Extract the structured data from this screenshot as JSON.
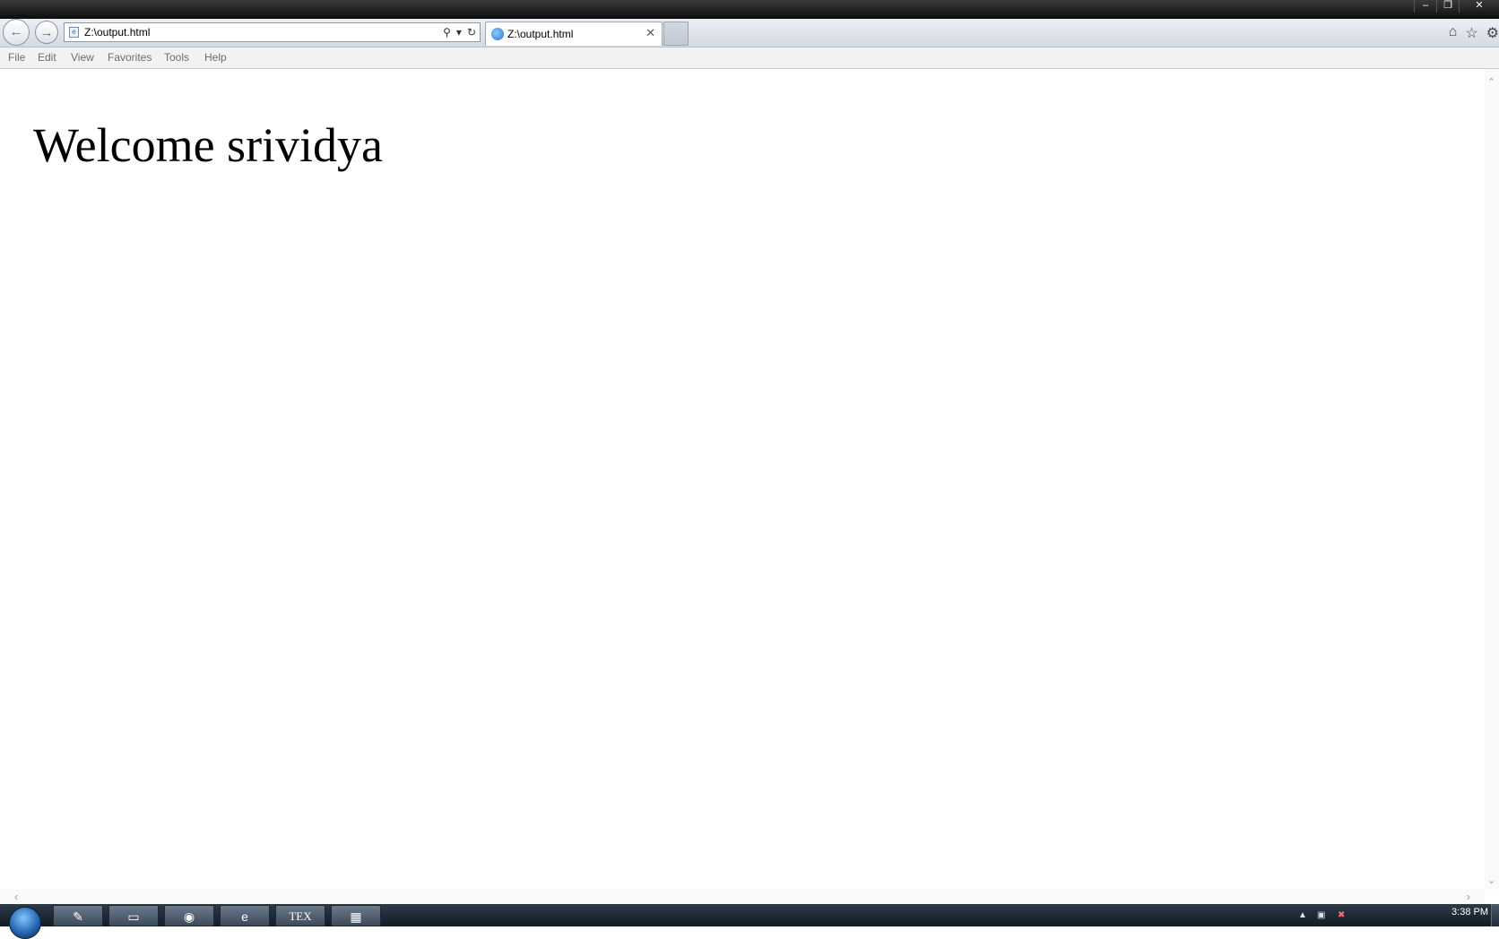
{
  "window": {
    "controls": {
      "minimize": "–",
      "restore": "❐",
      "close": "✕"
    }
  },
  "navbar": {
    "back_icon": "arrow-left-icon",
    "forward_icon": "arrow-right-icon",
    "address": {
      "value": "Z:\\output.html",
      "search_icon": "search-icon",
      "dropdown_icon": "chevron-down-icon",
      "refresh_icon": "refresh-icon"
    },
    "tab": {
      "label": "Z:\\output.html",
      "close": "✕"
    },
    "right_tools": {
      "home_icon": "home-icon",
      "favorites_icon": "star-icon",
      "tools_icon": "gear-icon"
    }
  },
  "menubar": {
    "items": [
      "File",
      "Edit",
      "View",
      "Favorites",
      "Tools",
      "Help"
    ]
  },
  "page": {
    "heading": "Welcome srividya"
  },
  "taskbar": {
    "apps": [
      {
        "icon": "editor-icon",
        "glyph": "✎"
      },
      {
        "icon": "folder-icon",
        "glyph": "▭"
      },
      {
        "icon": "chrome-icon",
        "glyph": "◉"
      },
      {
        "icon": "internet-explorer-icon",
        "glyph": "e"
      },
      {
        "icon": "tex-icon",
        "glyph": "TEX"
      },
      {
        "icon": "program-icon",
        "glyph": "▦"
      }
    ],
    "clock": "3:38 PM"
  },
  "colors": {
    "titlebar": "#0d0d0d",
    "taskbar": "#141b24",
    "menu_text": "#6d6d6d"
  }
}
